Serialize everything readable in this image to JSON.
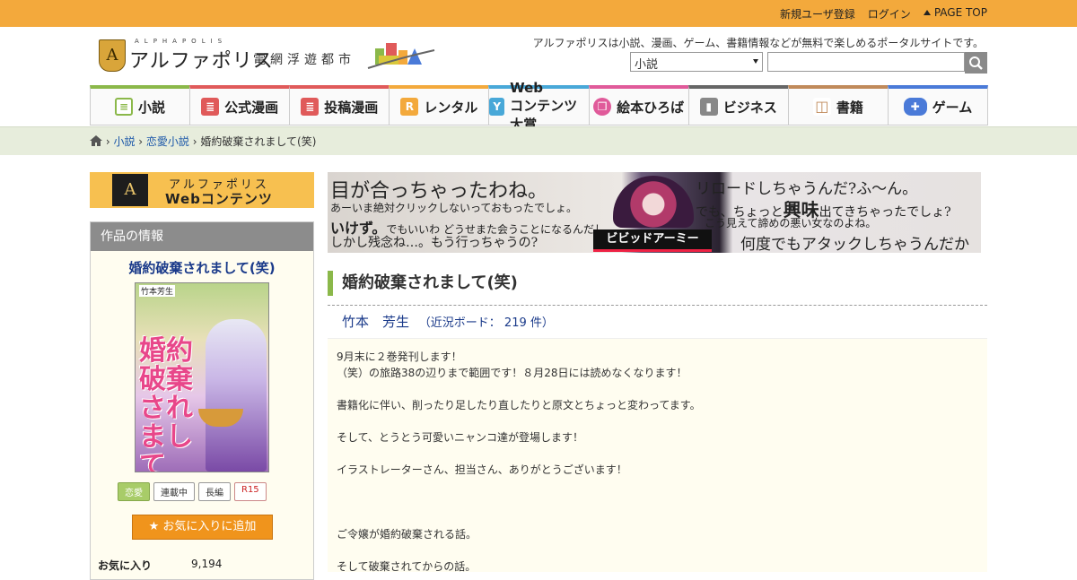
{
  "topbar": {
    "register": "新規ユーザ登録",
    "login": "ログイン",
    "pagetop": "PAGE TOP"
  },
  "header": {
    "logo_small": "ALPHAPOLIS",
    "logo_brand": "アルファポリス",
    "logo_tagline": "電網浮遊都市",
    "description": "アルファポリスは小説、漫画、ゲーム、書籍情報などが無料で楽しめるポータルサイトです。",
    "search_select_value": "小説",
    "search_placeholder": ""
  },
  "nav": {
    "tabs": [
      {
        "label": "小説",
        "color": "#8bb84a"
      },
      {
        "label": "公式漫画",
        "color": "#e05a5a"
      },
      {
        "label": "投稿漫画",
        "color": "#e05a5a"
      },
      {
        "label": "レンタル",
        "color": "#f3a93c"
      },
      {
        "label_top": "Web",
        "label_bottom": "コンテンツ大賞",
        "color": "#48a8d8"
      },
      {
        "label": "絵本ひろば",
        "color": "#e05a9a"
      },
      {
        "label": "ビジネス",
        "color": "#666666"
      },
      {
        "label": "書籍",
        "color": "#c08a5a"
      },
      {
        "label": "ゲーム",
        "color": "#4a7ad8"
      }
    ]
  },
  "breadcrumb": {
    "items": [
      "小説",
      "恋愛小説"
    ],
    "current": "婚約破棄されまして(笑)"
  },
  "sidebar": {
    "webcontents_line1": "アルファポリス",
    "webcontents_line2": "Webコンテンツ",
    "info_header": "作品の情報",
    "work_title": "婚約破棄されまして(笑)",
    "cover_author": "竹本芳生",
    "cover_title": "婚約破棄されまして(笑)",
    "tags": [
      "恋愛",
      "連載中",
      "長編",
      "R15"
    ],
    "fav_button": "お気に入りに追加",
    "fav_label": "お気に入り",
    "fav_value": "9,194"
  },
  "banner": {
    "left_line1": "目が合っちゃったわね。",
    "left_line2": "あーいま絶対クリックしないっておもったでしょ。",
    "left_line3a": "いけず。",
    "left_line3b": "でもいいわ どうせまた会うことになるんだし",
    "left_line4": "しかし残念ね…。もう行っちゃうの?",
    "right_line1": "リロードしちゃうんだ?ふ〜ん。",
    "right_line2a": "でも、ちょっと",
    "right_line2b": "興味",
    "right_line2c": "出てきちゃったでしょ?",
    "right_line3": "こう見えて諦めの悪い女なのよね。",
    "right_line4": "何度でもアタックしちゃうんだから。",
    "logo_text": "ビビッドアーミー"
  },
  "main": {
    "title": "婚約破棄されまして(笑)",
    "author": "竹本　芳生",
    "board_count": "（近況ボード： 219 件）",
    "description_lines": [
      "9月末に２巻発刊します！",
      "（笑）の旅路38の辺りまで範囲です！８月28日には読めなくなります！",
      "書籍化に伴い、削ったり足したり直したりと原文とちょっと変わってます。",
      "そして、とうとう可愛いニャンコ達が登場します！",
      "イラストレーターさん、担当さん、ありがとうございます！",
      "ご令嬢が婚約破棄される話。",
      "そして破棄されてからの話。"
    ]
  }
}
